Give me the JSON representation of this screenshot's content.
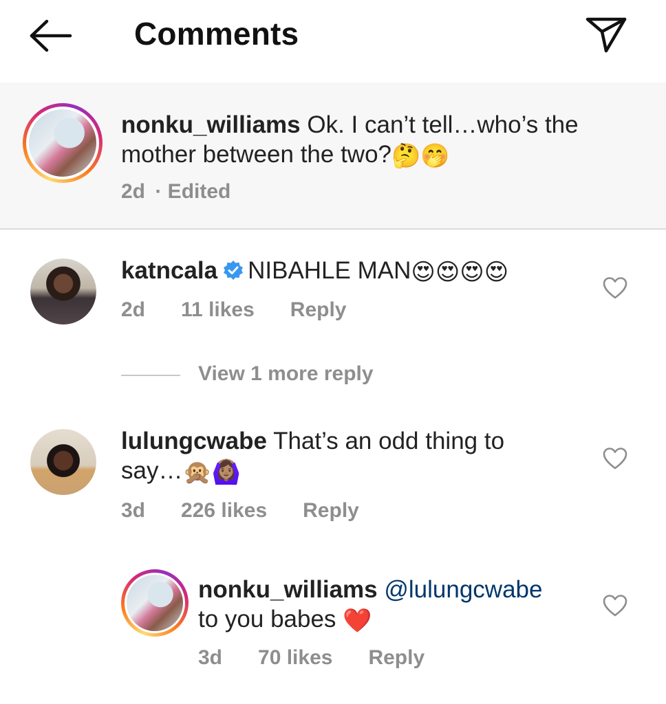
{
  "header": {
    "back_icon": "arrow-left-icon",
    "title": "Comments",
    "send_icon": "paper-plane-icon"
  },
  "caption": {
    "username": "nonku_williams",
    "text": "Ok. I can’t tell…who’s the mother between the two?",
    "emojis": "🤔🤭",
    "time": "2d",
    "edited": "· Edited"
  },
  "comments": [
    {
      "username": "katncala",
      "verified": true,
      "text": "NIBAHLE MAN",
      "emojis": "😍😍😍😍",
      "time": "2d",
      "likes": "11 likes",
      "reply": "Reply"
    },
    {
      "view_more": "View 1 more reply"
    },
    {
      "username": "lulungcwabe",
      "text": "That’s an odd thing to say…",
      "emojis": "🙊🙆🏽‍♀️",
      "time": "3d",
      "likes": "226 likes",
      "reply": "Reply"
    },
    {
      "username": "nonku_williams",
      "mention": "@lulungcwabe",
      "text": "to you babes",
      "emojis": "❤️",
      "time": "3d",
      "likes": "70 likes",
      "reply": "Reply"
    }
  ],
  "colors": {
    "meta_gray": "#8e8e8e",
    "mention_blue": "#00376b",
    "verified_blue": "#3897f0",
    "story_ring": [
      "#feda75",
      "#fa7e1e",
      "#d62976",
      "#962fbf"
    ]
  }
}
